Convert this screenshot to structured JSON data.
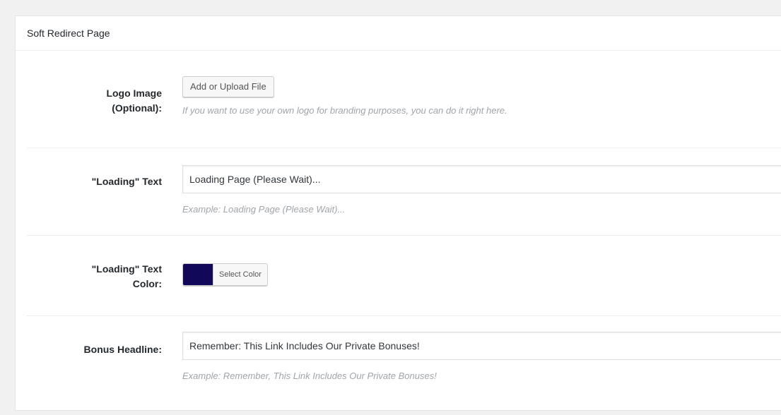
{
  "section": {
    "title": "Soft Redirect Page"
  },
  "logo": {
    "label_line1": "Logo Image",
    "label_line2": "(Optional):",
    "button_label": "Add or Upload File",
    "description": "If you want to use your own logo for branding purposes, you can do it right here."
  },
  "loading_text": {
    "label": "\"Loading\" Text",
    "value": "Loading Page (Please Wait)...",
    "example": "Example: Loading Page (Please Wait)..."
  },
  "loading_color": {
    "label_line1": "\"Loading\" Text",
    "label_line2": "Color:",
    "swatch_color": "#12085a",
    "button_label": "Select Color"
  },
  "bonus_headline": {
    "label": "Bonus Headline:",
    "value": "Remember: This Link Includes Our Private Bonuses!",
    "example": "Example: Remember, This Link Includes Our Private Bonuses!"
  }
}
